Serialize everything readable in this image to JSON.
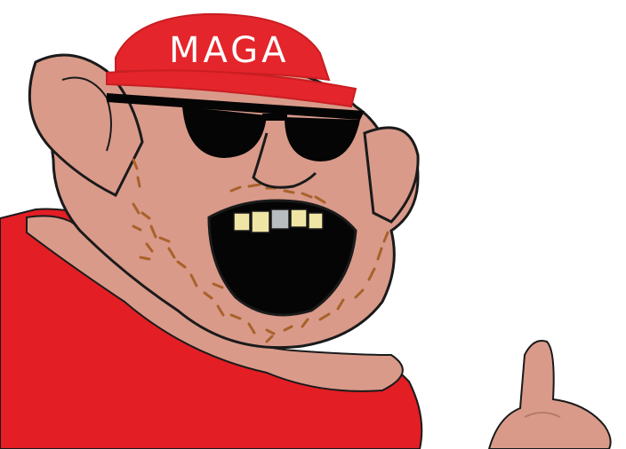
{
  "cap": {
    "text": "MAGA",
    "color": "#e4252b",
    "text_color": "#ffffff"
  },
  "colors": {
    "skin": "#d99a8a",
    "shirt": "#e31e24",
    "outline": "#1a1a1a",
    "beard": "#a8622a",
    "glasses": "#050505",
    "teeth": "#efe6a6",
    "gold_tooth": "#b9bdbf",
    "background": "#ffffff"
  }
}
